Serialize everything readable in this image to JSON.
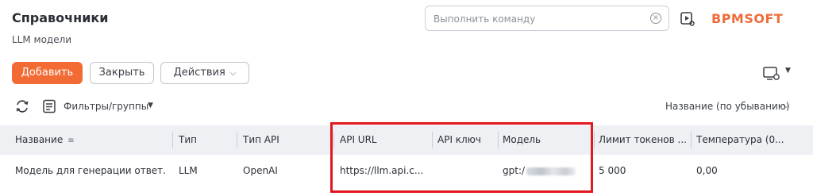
{
  "header": {
    "title": "Справочники",
    "subtitle": "LLM модели",
    "command_placeholder": "Выполнить команду",
    "logo_text": "BPMSOFT"
  },
  "toolbar": {
    "add_label": "Добавить",
    "close_label": "Закрыть",
    "actions_label": "Действия"
  },
  "filter": {
    "filters_label": "Фильтры/группы",
    "sort_label": "Название (по убыванию)"
  },
  "table": {
    "columns": [
      "Название",
      "Тип",
      "Тип API",
      "API URL",
      "API ключ",
      "Модель",
      "Лимит токенов ...",
      "Температура (0..."
    ],
    "rows": [
      {
        "name": "Модель для генерации ответ...",
        "type": "LLM",
        "api_type": "OpenAI",
        "api_url": "https://llm.api.c...",
        "api_key": "",
        "model": "gpt:/",
        "token_limit": "5 000",
        "temperature": "0,00"
      }
    ]
  },
  "colors": {
    "accent": "#f26b35",
    "highlight": "#e3171e",
    "header_bg": "#eef0f4"
  },
  "icons": [
    "clear-icon",
    "play-icon",
    "view-settings-icon",
    "refresh-icon",
    "filter-icon",
    "sort-icon",
    "chevron-down-icon"
  ]
}
